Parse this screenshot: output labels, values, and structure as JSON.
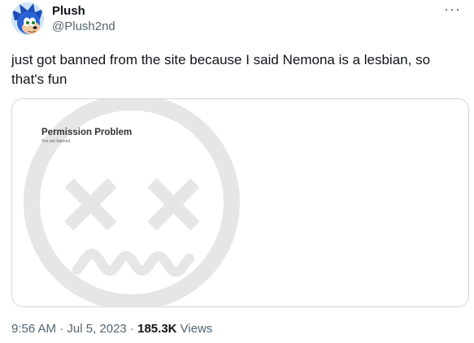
{
  "author": {
    "display_name": "Plush",
    "handle": "@Plush2nd"
  },
  "more_icon": "more-horizontal-icon",
  "more_glyph": "···",
  "tweet": {
    "text": "just got banned from the site because I said Nemona is a lesbian, so that's fun"
  },
  "media": {
    "title": "Permission Problem",
    "subtitle": "You are banned.",
    "icon": "banned-face-icon"
  },
  "meta": {
    "time": "9:56 AM",
    "separator": " · ",
    "date": "Jul 5, 2023",
    "views_count": "185.3K",
    "views_label": " Views"
  },
  "colors": {
    "text_primary": "#0f1419",
    "text_secondary": "#536471",
    "border": "#cfd9de",
    "graphic_gray": "#e6e6e6"
  }
}
